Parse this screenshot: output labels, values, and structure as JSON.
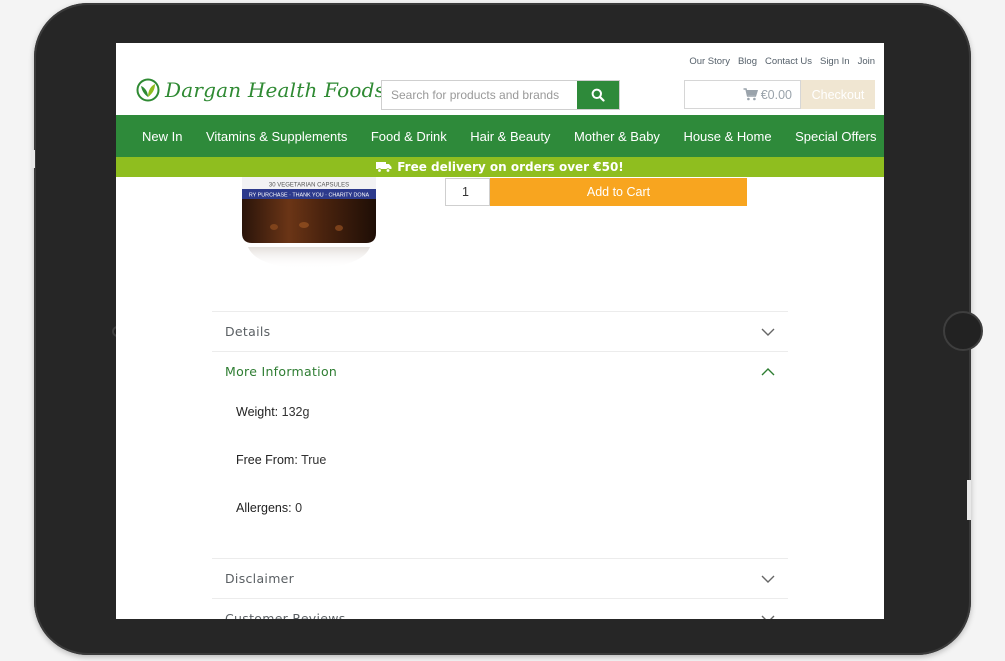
{
  "toplinks": [
    "Our Story",
    "Blog",
    "Contact Us",
    "Sign In",
    "Join"
  ],
  "logo": {
    "text": "Dargan Health Foods"
  },
  "search": {
    "placeholder": "Search for products and brands"
  },
  "cart": {
    "amount": "€0.00",
    "checkout_label": "Checkout"
  },
  "nav": [
    "New In",
    "Vitamins & Supplements",
    "Food & Drink",
    "Hair & Beauty",
    "Mother & Baby",
    "House & Home",
    "Special Offers"
  ],
  "banner": {
    "text": "Free delivery on orders over €50!"
  },
  "product": {
    "label_text": "30 VEGETARIAN CAPSULES",
    "band_text": "RY PURCHASE · THANK YOU · CHARITY DONA",
    "quantity": "1",
    "add_to_cart_label": "Add to Cart"
  },
  "accordion": {
    "details": "Details",
    "more_info": "More Information",
    "disclaimer": "Disclaimer",
    "reviews": "Customer Reviews"
  },
  "more_info_items": [
    {
      "key": "Weight:",
      "value": "132g"
    },
    {
      "key": "Free From:",
      "value": "True"
    },
    {
      "key": "Allergens:",
      "value": "0"
    }
  ],
  "colors": {
    "brand_green": "#2e8a3a",
    "banner_green": "#8fbe1f",
    "cta_orange": "#f8a51f",
    "checkout_beige": "#f0e6d2"
  }
}
